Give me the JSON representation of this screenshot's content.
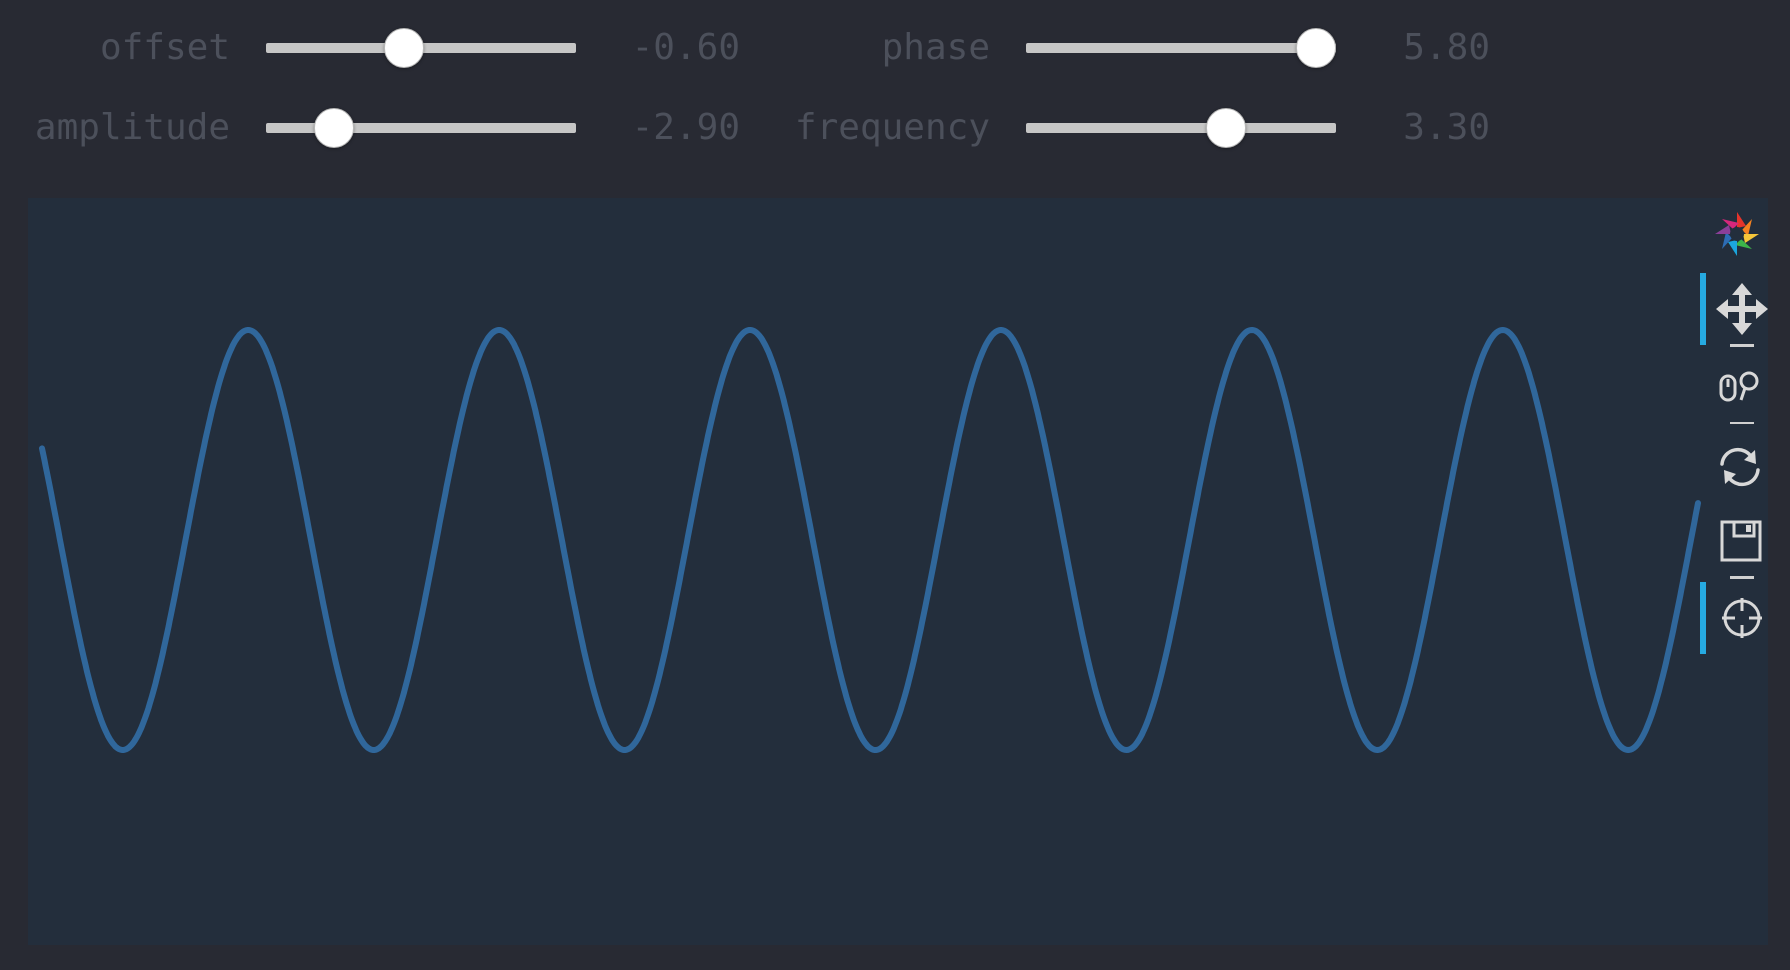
{
  "controls": [
    {
      "id": "offset",
      "label": "offset",
      "value_text": "-0.60",
      "fraction": 0.445
    },
    {
      "id": "phase",
      "label": "phase",
      "value_text": "5.80",
      "fraction": 0.935
    },
    {
      "id": "amplitude",
      "label": "amplitude",
      "value_text": "-2.90",
      "fraction": 0.22
    },
    {
      "id": "frequency",
      "label": "frequency",
      "value_text": "3.30",
      "fraction": 0.645
    }
  ],
  "toolbar": {
    "items": [
      {
        "name": "bokeh-logo-icon",
        "active": false
      },
      {
        "name": "pan-tool-icon",
        "active": true
      },
      {
        "name": "wheel-zoom-tool-icon",
        "active": false
      },
      {
        "name": "reset-tool-icon",
        "active": false
      },
      {
        "name": "save-tool-icon",
        "active": false
      },
      {
        "name": "crosshair-tool-icon",
        "active": true
      }
    ],
    "active_color": "#26aae1"
  },
  "chart_data": {
    "type": "line",
    "series": [
      {
        "color": "#30679b",
        "function": "sine",
        "cycles_visible": 6.6
      }
    ],
    "grid": false,
    "colors": {
      "background": "#232e3c",
      "page": "#282a33"
    }
  }
}
